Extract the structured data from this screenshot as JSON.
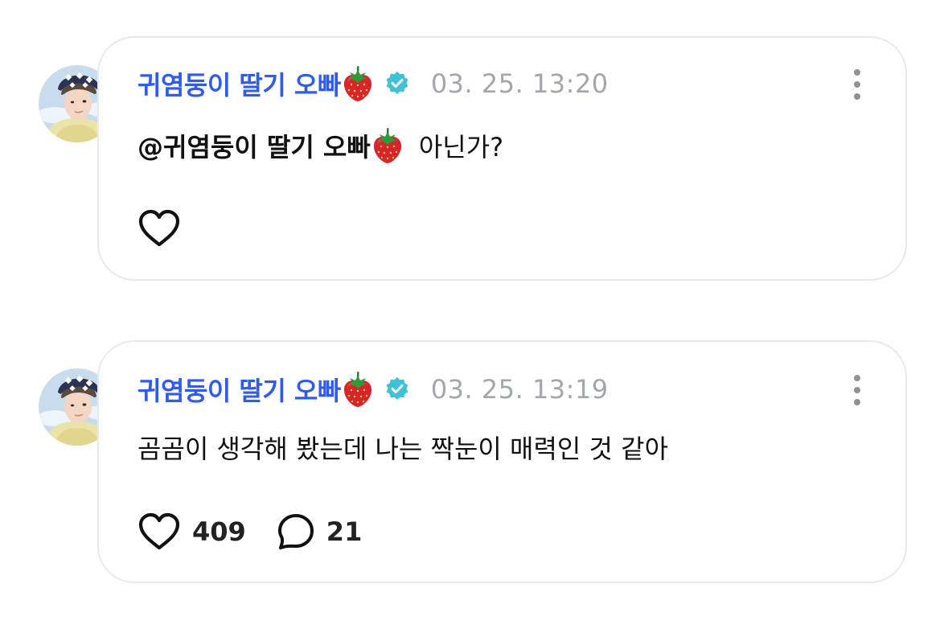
{
  "colors": {
    "author": "#2f5bf0",
    "verified_badge": "#3fc1d6",
    "timestamp": "#a3a6ad",
    "card_border": "#e9eaee",
    "text": "#111111"
  },
  "comments": [
    {
      "author": "귀염둥이 딸기 오빠",
      "author_emoji": "strawberry-icon",
      "verified": true,
      "timestamp": "03. 25. 13:20",
      "mention": "@귀염둥이 딸기 오빠",
      "text": "아닌가?",
      "likes": "",
      "replies": ""
    },
    {
      "author": "귀염둥이 딸기 오빠",
      "author_emoji": "strawberry-icon",
      "verified": true,
      "timestamp": "03. 25. 13:19",
      "text": "곰곰이 생각해 봤는데 나는 짝눈이 매력인 것 같아",
      "likes": "409",
      "replies": "21"
    }
  ]
}
